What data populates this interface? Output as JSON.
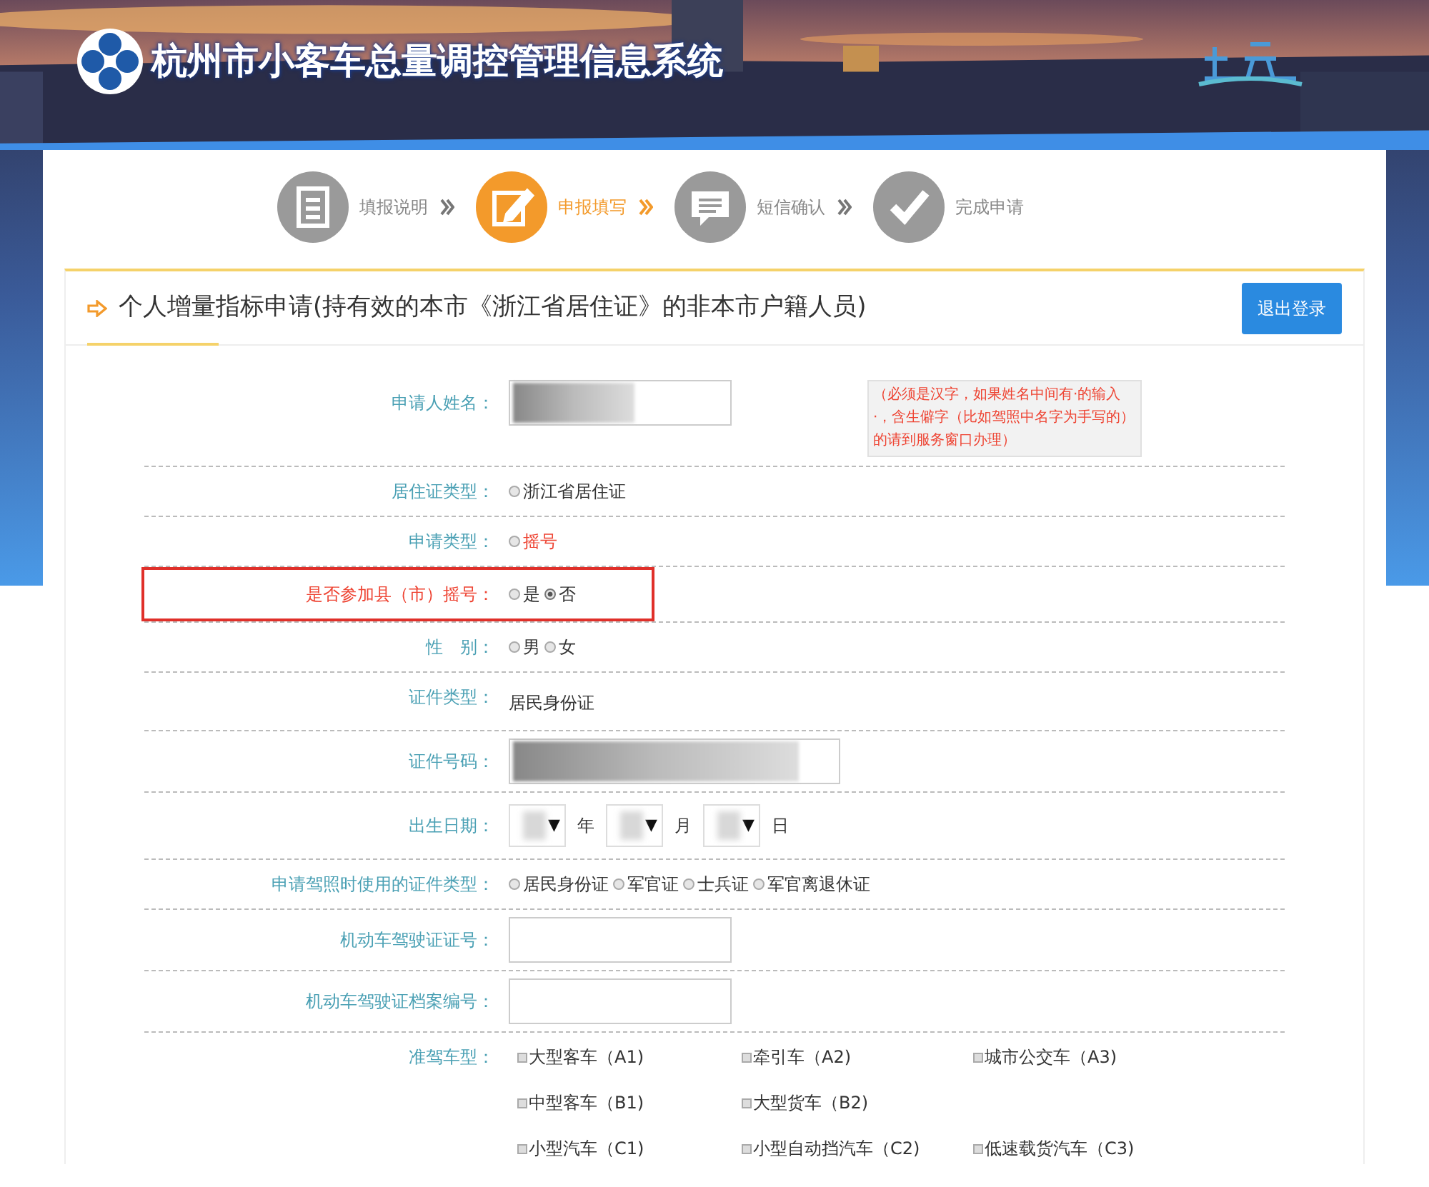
{
  "header": {
    "title": "杭州市小客车总量调控管理信息系统"
  },
  "steps": [
    {
      "label": "填报说明",
      "selected": false,
      "kind": "document"
    },
    {
      "label": "申报填写",
      "selected": true,
      "kind": "edit"
    },
    {
      "label": "短信确认",
      "selected": false,
      "kind": "message"
    },
    {
      "label": "完成申请",
      "selected": false,
      "kind": "check"
    }
  ],
  "form": {
    "title": "个人增量指标申请(持有效的本市《浙江省居住证》的非本市户籍人员)",
    "logout": "退出登录",
    "fields": [
      {
        "kind": "input",
        "label": "申请人姓名：",
        "redacted": true,
        "note": "（必须是汉字，如果姓名中间有·的输入·，含生僻字（比如驾照中名字为手写的）的请到服务窗口办理）"
      },
      {
        "kind": "radio",
        "label": "居住证类型：",
        "options": [
          {
            "label": "浙江省居住证",
            "selected": false
          }
        ]
      },
      {
        "kind": "radio",
        "label": "申请类型：",
        "value_alert": true,
        "options": [
          {
            "label": "摇号",
            "selected": false
          }
        ]
      },
      {
        "kind": "radio",
        "label": "是否参加县（市）摇号：",
        "flagged": true,
        "options": [
          {
            "label": "是",
            "selected": false
          },
          {
            "label": "否",
            "selected": true
          }
        ]
      },
      {
        "kind": "radio",
        "label": "性　别：",
        "options": [
          {
            "label": "男",
            "selected": false
          },
          {
            "label": "女",
            "selected": false
          }
        ]
      },
      {
        "kind": "text",
        "label": "证件类型：",
        "value": "居民身份证"
      },
      {
        "kind": "input",
        "label": "证件号码：",
        "redacted": true,
        "wide": true
      },
      {
        "kind": "date",
        "label": "出生日期：",
        "parts": [
          {
            "arrow": "▼",
            "unit": "年"
          },
          {
            "arrow": "▼",
            "unit": "月"
          },
          {
            "arrow": "▼",
            "unit": "日"
          }
        ]
      },
      {
        "kind": "radio",
        "label": "申请驾照时使用的证件类型：",
        "options": [
          {
            "label": "居民身份证",
            "selected": false
          },
          {
            "label": "军官证",
            "selected": false
          },
          {
            "label": "士兵证",
            "selected": false
          },
          {
            "label": "军官离退休证",
            "selected": false
          }
        ]
      },
      {
        "kind": "input",
        "label": "机动车驾驶证证号：",
        "redacted": false
      },
      {
        "kind": "input",
        "label": "机动车驾驶证档案编号：",
        "redacted": false
      },
      {
        "kind": "checkboxes",
        "label": "准驾车型：",
        "rows": [
          [
            {
              "label": "大型客车（A1)",
              "checked": false
            },
            {
              "label": "牵引车（A2)",
              "checked": false
            },
            {
              "label": "城市公交车（A3)",
              "checked": false
            }
          ],
          [
            {
              "label": "中型客车（B1)",
              "checked": false
            },
            {
              "label": "大型货车（B2)",
              "checked": false
            }
          ],
          [
            {
              "label": "小型汽车（C1)",
              "checked": false
            },
            {
              "label": "小型自动挡汽车（C2)",
              "checked": false
            },
            {
              "label": "低速载货汽车（C3)",
              "checked": false
            }
          ]
        ]
      }
    ]
  }
}
